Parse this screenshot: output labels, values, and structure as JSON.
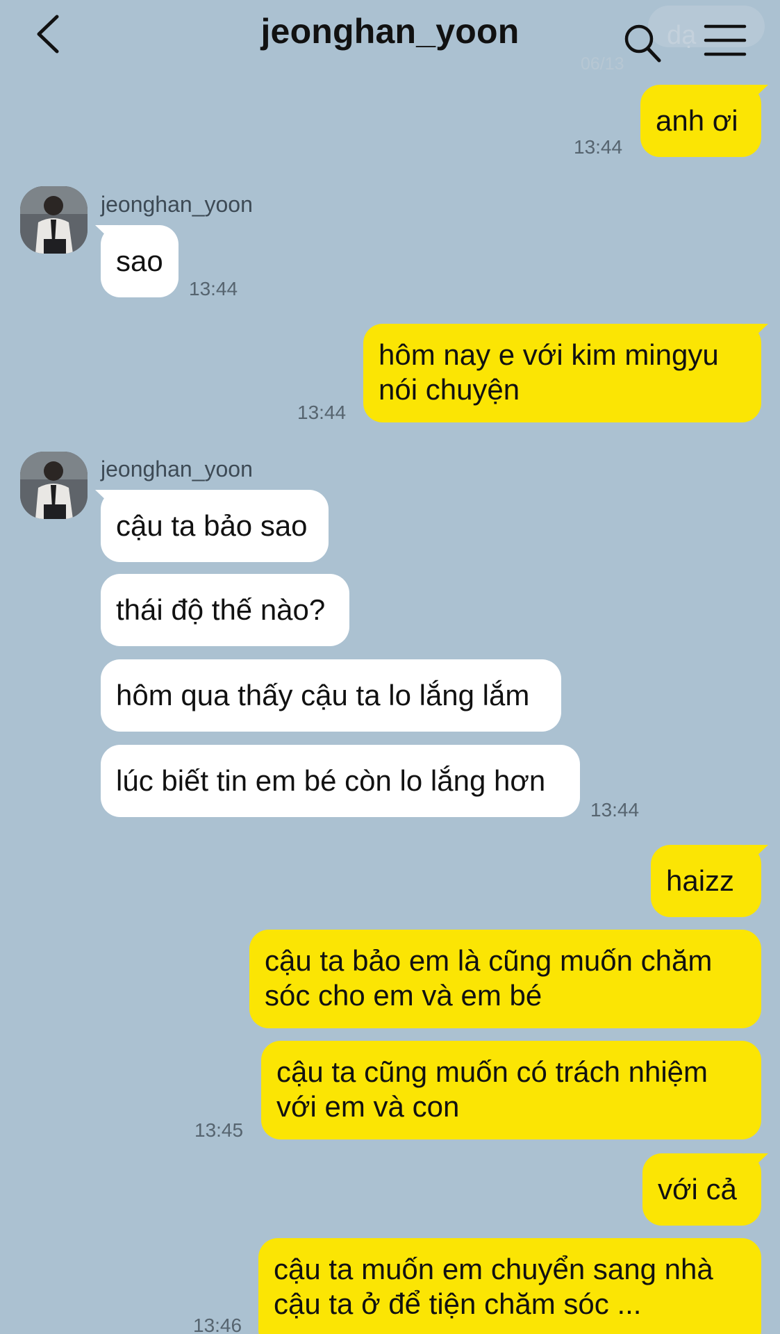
{
  "header": {
    "title": "jeonghan_yoon",
    "ghost_text": "dạ",
    "ghost_time": "06/13"
  },
  "contact": {
    "name": "jeonghan_yoon"
  },
  "messages": {
    "m1": {
      "text": "anh ơi",
      "time": "13:44"
    },
    "m2": {
      "text": "sao",
      "time": "13:44"
    },
    "m3": {
      "line1": "hôm nay e với kim mingyu",
      "line2": "nói chuyện",
      "time": "13:44"
    },
    "m4": {
      "text": "cậu ta bảo sao"
    },
    "m5": {
      "text": "thái độ thế nào?"
    },
    "m6": {
      "text": "hôm qua thấy cậu ta lo lắng lắm"
    },
    "m7": {
      "text": "lúc biết tin em bé còn lo lắng hơn",
      "time": "13:44"
    },
    "m8": {
      "text": "haizz"
    },
    "m9": {
      "line1": "cậu ta bảo em là cũng muốn chăm",
      "line2": "sóc cho em và em bé"
    },
    "m10": {
      "line1": "cậu ta cũng muốn có trách nhiệm",
      "line2": "với em và con",
      "time": "13:45"
    },
    "m11": {
      "text": "với cả"
    },
    "m12": {
      "line1": "cậu ta muốn em chuyển sang nhà",
      "line2": "cậu ta ở để tiện chăm sóc ...",
      "time": "13:46"
    }
  },
  "colors": {
    "background": "#abc1d1",
    "outgoing_bubble": "#fbe504",
    "incoming_bubble": "#ffffff"
  },
  "icons": [
    "back-icon",
    "search-icon",
    "menu-icon"
  ]
}
